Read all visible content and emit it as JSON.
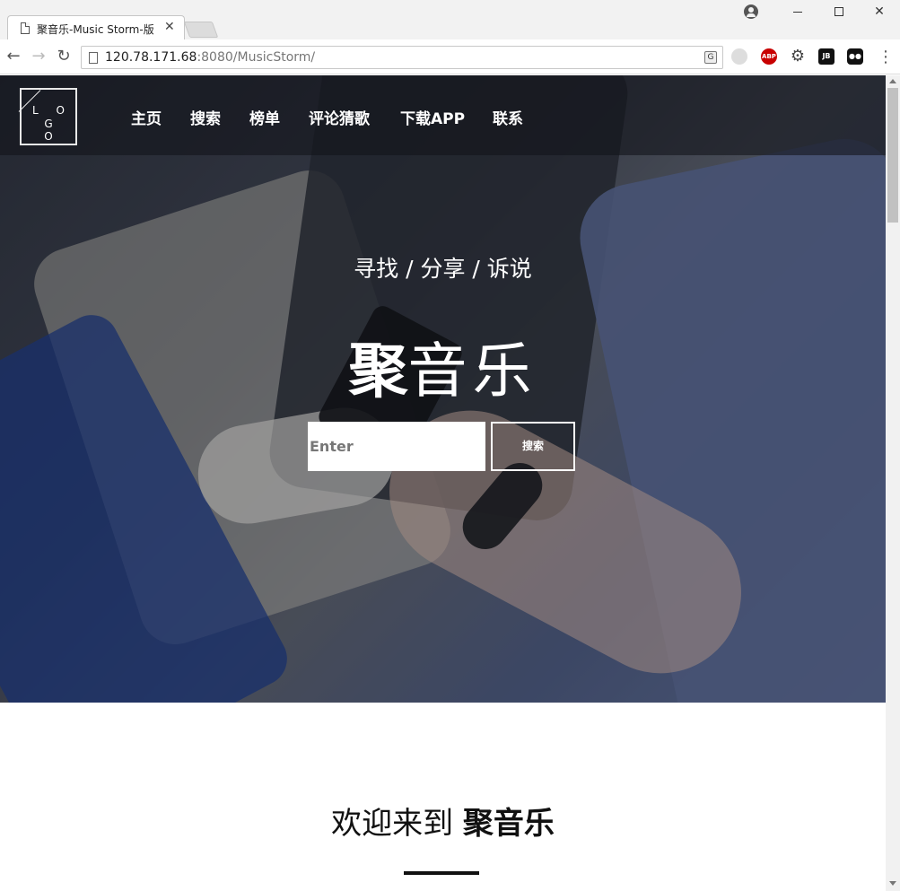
{
  "browser": {
    "tab_title": "聚音乐-Music Storm-版",
    "tab_close": "✕",
    "url_host": "120.78.171.68",
    "url_rest": ":8080/MusicStorm/",
    "window_buttons": {
      "close": "✕"
    },
    "extensions": {
      "abp": "ABP",
      "jb": "JB"
    }
  },
  "site": {
    "logo": {
      "row1": "L O",
      "row2": "G O"
    },
    "nav": {
      "home": "主页",
      "search": "搜索",
      "charts": "榜单",
      "guess": "评论猜歌",
      "app": "下载APP",
      "contact": "联系"
    },
    "hero": {
      "tagline": "寻找 / 分享 / 诉说",
      "title_bold": "聚",
      "title_light": "音乐",
      "search_placeholder": "Enter",
      "search_button": "搜索"
    },
    "welcome": {
      "prefix": "欢迎来到 ",
      "brand": "聚音乐"
    }
  },
  "colors": {
    "header_overlay": "#12141a",
    "text_on_hero": "#ffffff",
    "welcome_text": "#111111"
  }
}
